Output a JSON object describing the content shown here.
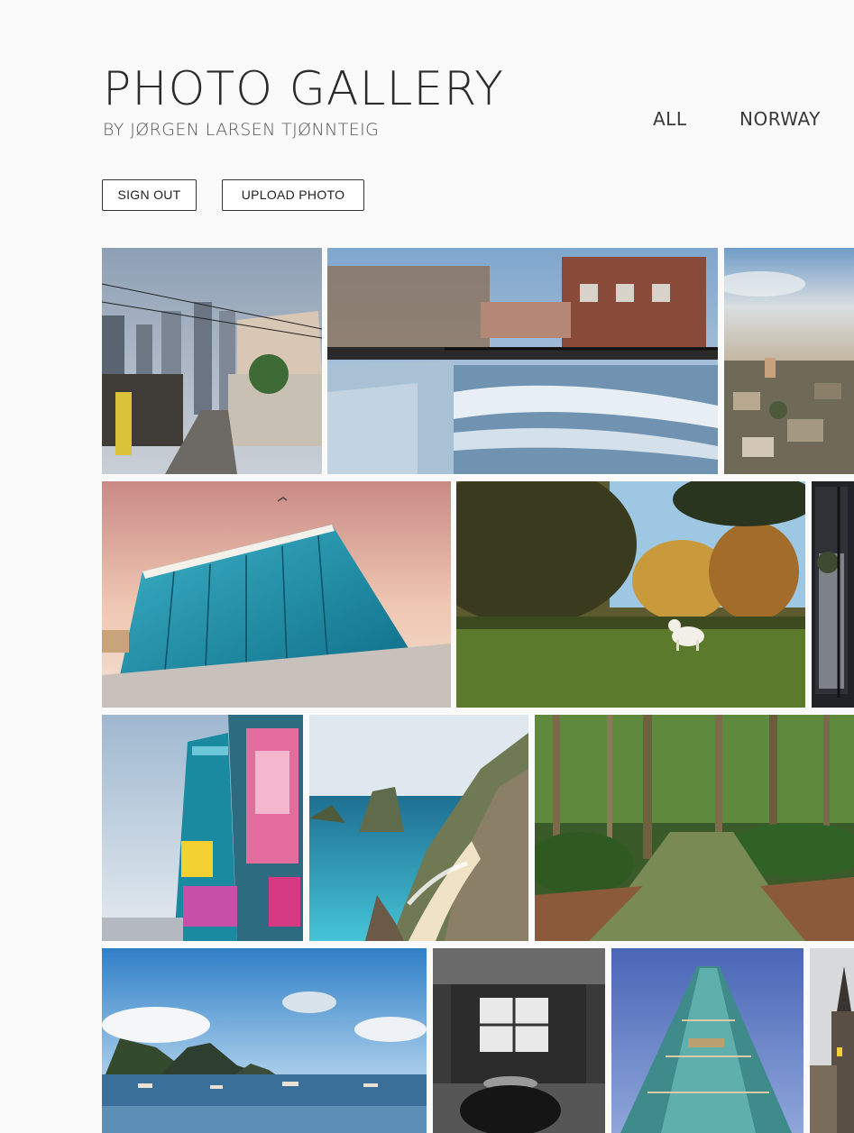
{
  "header": {
    "title": "PHOTO GALLERY",
    "subtitle": "BY JØRGEN LARSEN TJØNNTEIG"
  },
  "nav": {
    "items": [
      {
        "label": "ALL"
      },
      {
        "label": "NORWAY"
      }
    ]
  },
  "actions": {
    "sign_out_label": "SIGN OUT",
    "upload_label": "UPLOAD PHOTO"
  },
  "colors": {
    "background": "#fafafa",
    "text": "#2b2b2b",
    "button_border": "#333333"
  },
  "gallery": {
    "photos": [
      {
        "subject": "city-street-with-skyscrapers"
      },
      {
        "subject": "river-rapids-with-bridge-and-brick-buildings"
      },
      {
        "subject": "aerial-city-view-at-dusk"
      },
      {
        "subject": "glass-opera-house-at-sunset"
      },
      {
        "subject": "dog-in-park-autumn"
      },
      {
        "subject": "dark-doorway"
      },
      {
        "subject": "tall-building-with-billboards"
      },
      {
        "subject": "tropical-coastline-cliffs"
      },
      {
        "subject": "forest-path"
      },
      {
        "subject": "bay-with-boats-and-mountains"
      },
      {
        "subject": "abandoned-room-window"
      },
      {
        "subject": "skyscraper-looking-up"
      },
      {
        "subject": "cathedral-towers"
      }
    ]
  }
}
